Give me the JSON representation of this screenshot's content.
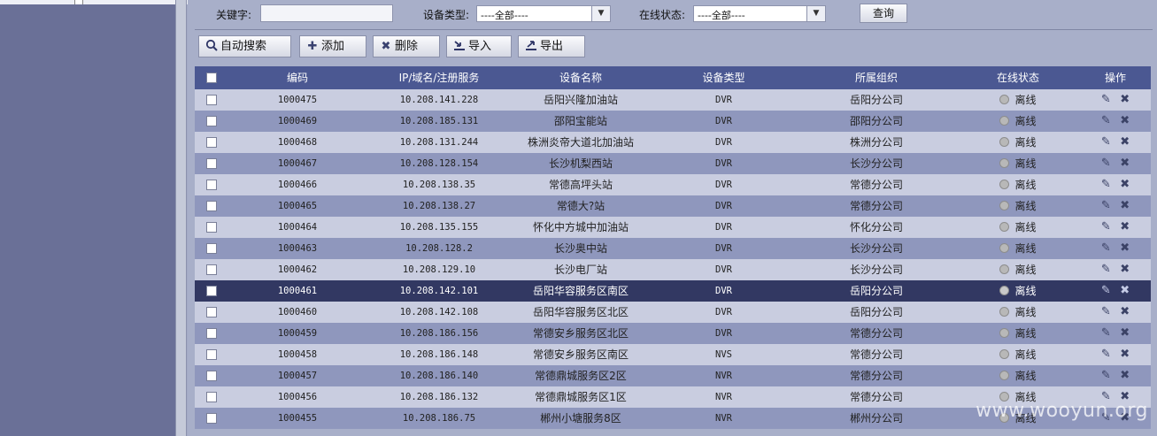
{
  "filters": {
    "keyword_label": "关键字:",
    "keyword_value": "",
    "device_type_label": "设备类型:",
    "device_type_value": "----全部----",
    "online_status_label": "在线状态:",
    "online_status_value": "----全部----",
    "query_button": "查询"
  },
  "toolbar": {
    "auto_search": "自动搜索",
    "add": "添加",
    "delete": "删除",
    "import": "导入",
    "export": "导出"
  },
  "table": {
    "columns": [
      "编码",
      "IP/域名/注册服务",
      "设备名称",
      "设备类型",
      "所属组织",
      "在线状态",
      "操作"
    ],
    "rows": [
      {
        "code": "1000475",
        "ip": "10.208.141.228",
        "name": "岳阳兴隆加油站",
        "type": "DVR",
        "org": "岳阳分公司",
        "status": "离线"
      },
      {
        "code": "1000469",
        "ip": "10.208.185.131",
        "name": "邵阳宝能站",
        "type": "DVR",
        "org": "邵阳分公司",
        "status": "离线"
      },
      {
        "code": "1000468",
        "ip": "10.208.131.244",
        "name": "株洲炎帝大道北加油站",
        "type": "DVR",
        "org": "株洲分公司",
        "status": "离线"
      },
      {
        "code": "1000467",
        "ip": "10.208.128.154",
        "name": "长沙机梨西站",
        "type": "DVR",
        "org": "长沙分公司",
        "status": "离线"
      },
      {
        "code": "1000466",
        "ip": "10.208.138.35",
        "name": "常德高坪头站",
        "type": "DVR",
        "org": "常德分公司",
        "status": "离线"
      },
      {
        "code": "1000465",
        "ip": "10.208.138.27",
        "name": "常德大?站",
        "type": "DVR",
        "org": "常德分公司",
        "status": "离线"
      },
      {
        "code": "1000464",
        "ip": "10.208.135.155",
        "name": "怀化中方城中加油站",
        "type": "DVR",
        "org": "怀化分公司",
        "status": "离线"
      },
      {
        "code": "1000463",
        "ip": "10.208.128.2",
        "name": "长沙奥中站",
        "type": "DVR",
        "org": "长沙分公司",
        "status": "离线"
      },
      {
        "code": "1000462",
        "ip": "10.208.129.10",
        "name": "长沙电厂站",
        "type": "DVR",
        "org": "长沙分公司",
        "status": "离线"
      },
      {
        "code": "1000461",
        "ip": "10.208.142.101",
        "name": "岳阳华容服务区南区",
        "type": "DVR",
        "org": "岳阳分公司",
        "status": "离线"
      },
      {
        "code": "1000460",
        "ip": "10.208.142.108",
        "name": "岳阳华容服务区北区",
        "type": "DVR",
        "org": "岳阳分公司",
        "status": "离线"
      },
      {
        "code": "1000459",
        "ip": "10.208.186.156",
        "name": "常德安乡服务区北区",
        "type": "DVR",
        "org": "常德分公司",
        "status": "离线"
      },
      {
        "code": "1000458",
        "ip": "10.208.186.148",
        "name": "常德安乡服务区南区",
        "type": "NVS",
        "org": "常德分公司",
        "status": "离线"
      },
      {
        "code": "1000457",
        "ip": "10.208.186.140",
        "name": "常德鼎城服务区2区",
        "type": "NVR",
        "org": "常德分公司",
        "status": "离线"
      },
      {
        "code": "1000456",
        "ip": "10.208.186.132",
        "name": "常德鼎城服务区1区",
        "type": "NVR",
        "org": "常德分公司",
        "status": "离线"
      },
      {
        "code": "1000455",
        "ip": "10.208.186.75",
        "name": "郴州小塘服务8区",
        "type": "NVR",
        "org": "郴州分公司",
        "status": "离线"
      }
    ],
    "selected_index": 9
  },
  "icons": {
    "search": "magnifier-icon",
    "add": "plus-icon",
    "delete": "x-icon",
    "import": "import-arrow-icon",
    "export": "export-arrow-icon",
    "edit": "pencil-icon",
    "remove": "x-icon"
  },
  "colors": {
    "sidebar": "#6a7097",
    "header": "#4b5892",
    "row_light": "#c9cde0",
    "row_dark": "#8f97bd",
    "row_selected": "#323862"
  },
  "watermark": "www.wooyun.org"
}
